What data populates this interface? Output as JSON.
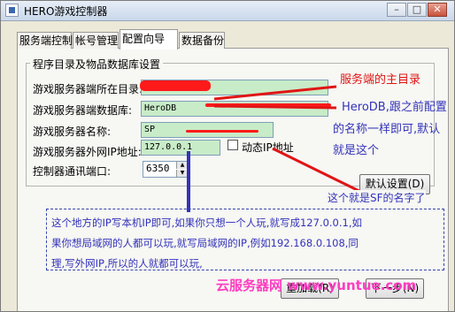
{
  "window": {
    "title": "HERO游戏控制器",
    "buttons": {
      "minimize": "–",
      "maximize": "□",
      "close": "✕"
    }
  },
  "tabs": [
    {
      "label": "服务端控制",
      "active": false
    },
    {
      "label": "帐号管理",
      "active": false
    },
    {
      "label": "配置向导",
      "active": true
    },
    {
      "label": "数据备份",
      "active": false
    }
  ],
  "group": {
    "title": "程序目录及物品数据库设置",
    "fields": {
      "dir": {
        "label": "游戏服务器端所在目录:",
        "value": ""
      },
      "db": {
        "label": "游戏服务器端数据库:",
        "value": "HeroDB"
      },
      "name": {
        "label": "游戏服务器名称:",
        "value": "SP"
      },
      "ip": {
        "label": "游戏服务器外网IP地址:",
        "value": "127.0.0.1"
      },
      "dynamic_ip": {
        "label": "动态IP地址",
        "checked": false
      },
      "port": {
        "label": "控制器通讯端口:",
        "value": "6350"
      }
    },
    "default_button": "默认设置(D)"
  },
  "footer": {
    "reload_button": "重加载(R)",
    "next_button": "下一步(N)"
  },
  "annotations": {
    "server_dir": "服务端的主目录",
    "herodb_note": [
      "HeroDB,跟之前配置",
      "的名称一样即可,默认",
      "就是这个"
    ],
    "sf_name_note": "这个就是SF的名字了",
    "ip_note": [
      "这个地方的IP写本机IP即可,如果你只想一个人玩,就写成127.0.0.1,如",
      "果你想局域网的人都可以玩,就写局域网的IP,例如192.168.0.108,同",
      "理,写外网IP,所以的人就都可以玩,"
    ],
    "watermark": "云服务器网 www.yuntue.com"
  },
  "colors": {
    "field_bg": "#c8ecc8",
    "annotation_red": "#e01515",
    "annotation_blue": "#3333bb",
    "watermark": "#ff3cc0"
  }
}
